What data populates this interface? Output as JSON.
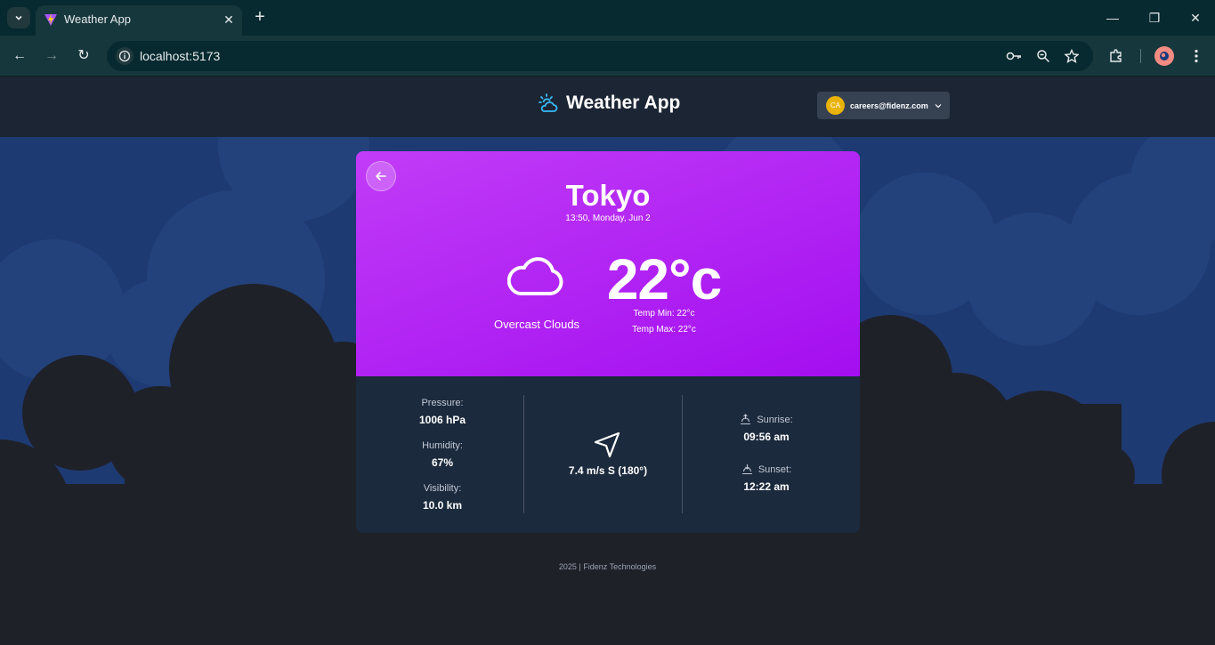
{
  "browser": {
    "tab_title": "Weather App",
    "url": "localhost:5173"
  },
  "app": {
    "title": "Weather App",
    "user_initials": "CA",
    "user_email": "careers@fidenz.com"
  },
  "weather": {
    "city": "Tokyo",
    "datetime": "13:50, Monday, Jun 2",
    "condition": "Overcast Clouds",
    "condition_icon": "cloud-icon",
    "temperature": "22°c",
    "temp_min": "Temp Min: 22°c",
    "temp_max": "Temp Max: 22°c"
  },
  "details": {
    "pressure_label": "Pressure:",
    "pressure_value": "1006 hPa",
    "humidity_label": "Humidity:",
    "humidity_value": "67%",
    "visibility_label": "Visibility:",
    "visibility_value": "10.0 km",
    "wind": "7.4 m/s S (180°)",
    "sunrise_label": "Sunrise:",
    "sunrise_value": "09:56 am",
    "sunset_label": "Sunset:",
    "sunset_value": "12:22 am"
  },
  "footer": "2025 | Fidenz Technologies",
  "colors": {
    "card_gradient_start": "#c13cf7",
    "card_gradient_end": "#a30ef0",
    "header_bg": "#1c2533",
    "sky_bg": "#1e3a72",
    "cloud_dark": "#1f2129",
    "accent_icon": "#38bdf8"
  }
}
